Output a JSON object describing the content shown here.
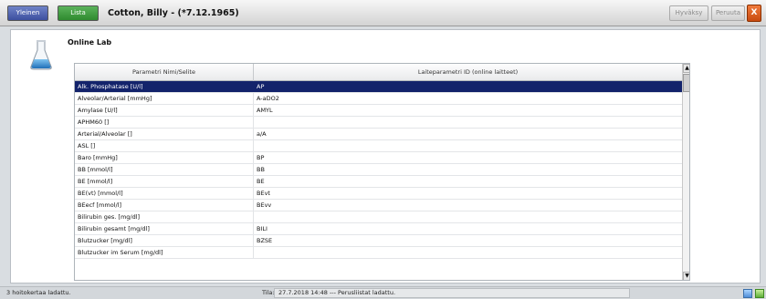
{
  "titlebar": {
    "home_label": "Yleinen",
    "list_label": "Lista",
    "patient": "Cotton, Billy - (*7.12.1965)",
    "accept_label": "Hyväksy",
    "cancel_label": "Peruuta",
    "close_label": "X"
  },
  "section": {
    "title": "Online Lab",
    "icon": "flask-icon"
  },
  "grid": {
    "headers": [
      "Parametri Nimi/Selite",
      "Laiteparametri ID (online laitteet)"
    ],
    "rows": [
      {
        "name": "Alk. Phosphatase [U/l]",
        "id": "AP",
        "selected": true
      },
      {
        "name": "Alveolar/Arterial [mmHg]",
        "id": "A-aDO2"
      },
      {
        "name": "Amylase [U/l]",
        "id": "AMYL"
      },
      {
        "name": "APHM60 []",
        "id": ""
      },
      {
        "name": "Arterial/Alveolar []",
        "id": "a/A"
      },
      {
        "name": "ASL []",
        "id": ""
      },
      {
        "name": "Baro [mmHg]",
        "id": "BP"
      },
      {
        "name": "BB [mmol/l]",
        "id": "BB"
      },
      {
        "name": "BE [mmol/l]",
        "id": "BE"
      },
      {
        "name": "BE(vt) [mmol/l]",
        "id": "BEvt"
      },
      {
        "name": "BEecf [mmol/l]",
        "id": "BEvv"
      },
      {
        "name": "Bilirubin ges. [mg/dl]",
        "id": ""
      },
      {
        "name": "Bilirubin gesamt [mg/dl]",
        "id": "BILI"
      },
      {
        "name": "Blutzucker [mg/dl]",
        "id": "BZSE"
      },
      {
        "name": "Blutzucker im Serum [mg/dl]",
        "id": ""
      }
    ]
  },
  "statusbar": {
    "left": "3 hoitokertaa ladattu.",
    "tila_label": "Tila:",
    "message": "27.7.2018 14:48 --- Perusliistat ladattu."
  },
  "colors": {
    "selection": "#13236b",
    "home_button": "#4a5eb0",
    "list_button": "#3c9a3c",
    "close_button": "#e0621f"
  }
}
